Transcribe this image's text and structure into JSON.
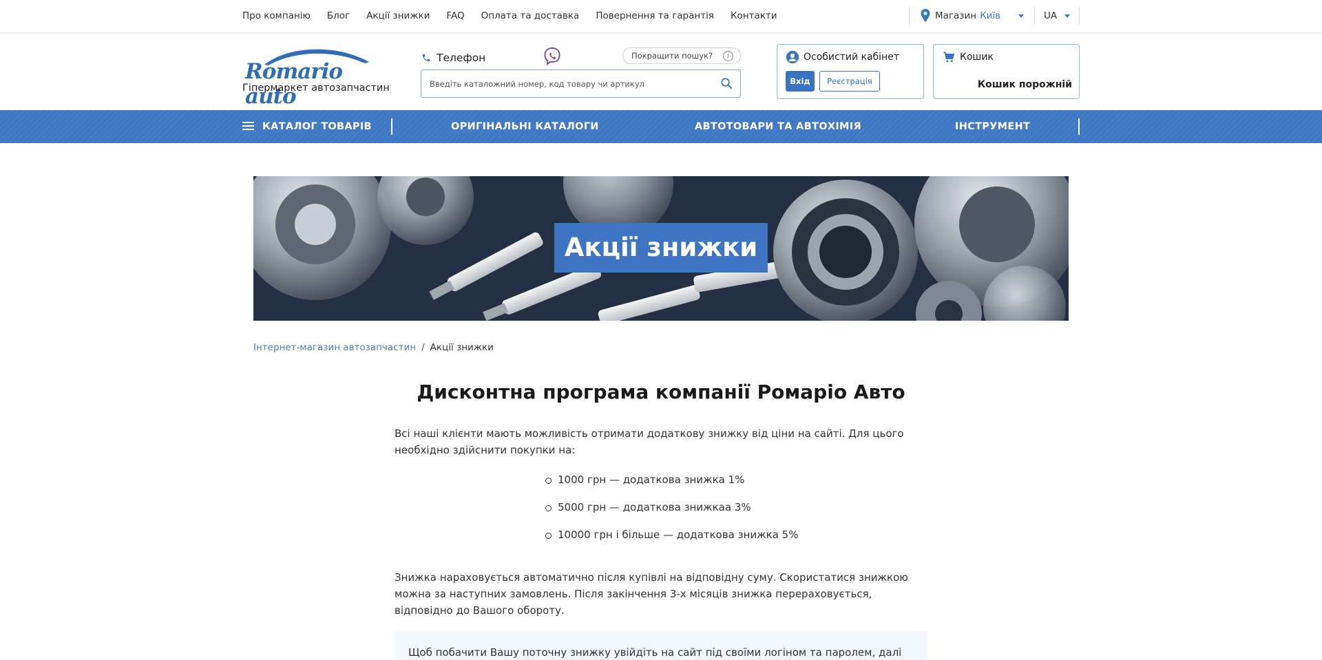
{
  "topnav": {
    "items": [
      "Про компанію",
      "Блог",
      "Акції знижки",
      "FAQ",
      "Оплата та доставка",
      "Повернення та гарантія",
      "Контакти"
    ],
    "store_label": "Магазин",
    "store_city": "Київ",
    "lang": "UA"
  },
  "header": {
    "logo_text": "Romario auto",
    "logo_subtitle": "Гіпермаркет автозапчастин",
    "phone_label": "Телефон",
    "improve_search": "Покращити пошук?",
    "search_placeholder": "Введіть каталожний номер, код товару чи артикул",
    "cabinet_title": "Особистий кабінет",
    "login_label": "Вхід",
    "register_label": "Реєстрація",
    "cart_title": "Кошик",
    "cart_status": "Кошик порожній"
  },
  "mainnav": {
    "catalog": "КАТАЛОГ ТОВАРІВ",
    "original": "ОРИГІНАЛЬНІ КАТАЛОГИ",
    "autogoods": "АВТОТОВАРИ ТА АВТОХІМІЯ",
    "tools": "ІНСТРУМЕНТ"
  },
  "banner": {
    "title": "Акції знижки"
  },
  "breadcrumb": {
    "home": "Інтернет-магазин автозапчастин",
    "separator": "/",
    "current": "Акції знижки"
  },
  "content": {
    "heading": "Дисконтна програма компанії Ромаріо Авто",
    "intro": "Всі наші клієнти мають можливість отримати додаткову знижку від ціни на сайті. Для цього необхідно здійснити покупки на:",
    "tiers": [
      "1000 грн — додаткова знижка 1%",
      "5000 грн — додаткова знижкаа 3%",
      "10000 грн і більше — додаткова знижка 5%"
    ],
    "details": "Знижка нараховується автоматично після купівлі на відповідну суму. Скористатися знижкою можна за наступних замовлень. Після закінчення 3-х місяців знижка перераховується, відповідно до Вашого обороту.",
    "note": "Щоб побачити Вашу поточну знижку увійдіть на сайт під своїми логіном та паролем, далі"
  },
  "colors": {
    "brand_blue": "#3f78c4",
    "link_blue": "#5479a8",
    "note_bg": "#f1f7fd"
  }
}
